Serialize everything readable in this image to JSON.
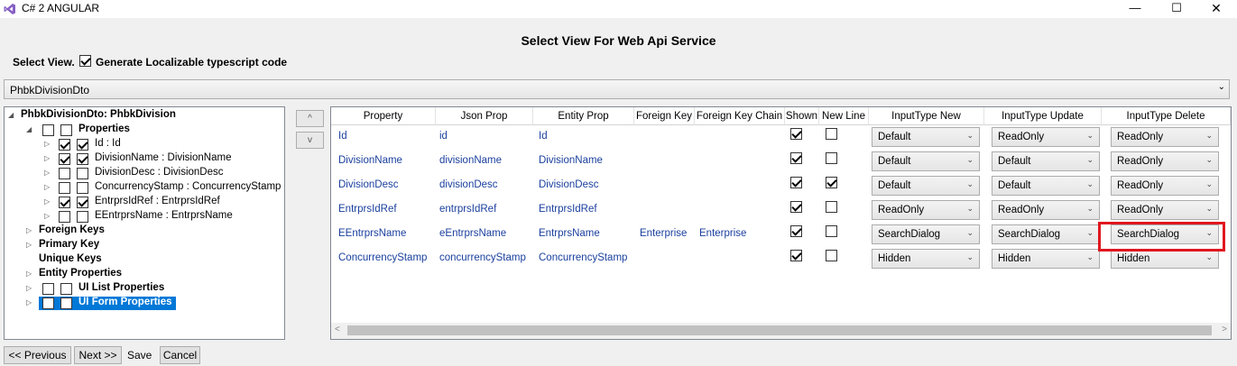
{
  "window": {
    "title": "C# 2 ANGULAR",
    "minimize": "—",
    "maximize": "☐",
    "close": "✕"
  },
  "heading": "Select View For Web Api Service",
  "select_view_label": "Select View.",
  "generate_checkbox": {
    "label": "Generate Localizable typescript code",
    "checked": true
  },
  "view_select": {
    "value": "PhbkDivisionDto",
    "arrow": "⌄"
  },
  "tree": {
    "root": "PhbkDivisionDto: PhbkDivision",
    "properties": {
      "label": "Properties",
      "checked": false
    },
    "items": [
      {
        "label": "Id : Id",
        "checked1": true,
        "checked2": true
      },
      {
        "label": "DivisionName : DivisionName",
        "checked1": true,
        "checked2": true
      },
      {
        "label": "DivisionDesc : DivisionDesc",
        "checked1": false,
        "checked2": false
      },
      {
        "label": "ConcurrencyStamp : ConcurrencyStamp",
        "checked1": false,
        "checked2": false
      },
      {
        "label": "EntrprsIdRef : EntrprsIdRef",
        "checked1": true,
        "checked2": true
      },
      {
        "label": "EEntrprsName : EntrprsName",
        "checked1": false,
        "checked2": false
      }
    ],
    "foreign_keys": "Foreign Keys",
    "primary_key": "Primary Key",
    "unique_keys": "Unique Keys",
    "entity_properties": "Entity Properties",
    "ui_list_properties": "UI List Properties",
    "ui_form_properties": "UI Form Properties"
  },
  "move_up": "^",
  "move_down": "v",
  "grid": {
    "columns": [
      "Property",
      "Json Prop",
      "Entity Prop",
      "Foreign Key",
      "Foreign Key Chain",
      "Shown",
      "New Line",
      "InputType New",
      "InputType Update",
      "InputType Delete"
    ],
    "rows": [
      {
        "property": "Id",
        "json_prop": "id",
        "entity_prop": "Id",
        "foreign_key": "",
        "foreign_key_chain": "",
        "shown": true,
        "new_line": false,
        "input_new": "Default",
        "input_update": "ReadOnly",
        "input_delete": "ReadOnly"
      },
      {
        "property": "DivisionName",
        "json_prop": "divisionName",
        "entity_prop": "DivisionName",
        "foreign_key": "",
        "foreign_key_chain": "",
        "shown": true,
        "new_line": false,
        "input_new": "Default",
        "input_update": "Default",
        "input_delete": "ReadOnly"
      },
      {
        "property": "DivisionDesc",
        "json_prop": "divisionDesc",
        "entity_prop": "DivisionDesc",
        "foreign_key": "",
        "foreign_key_chain": "",
        "shown": true,
        "new_line": true,
        "input_new": "Default",
        "input_update": "Default",
        "input_delete": "ReadOnly"
      },
      {
        "property": "EntrprsIdRef",
        "json_prop": "entrprsIdRef",
        "entity_prop": "EntrprsIdRef",
        "foreign_key": "",
        "foreign_key_chain": "",
        "shown": true,
        "new_line": false,
        "input_new": "ReadOnly",
        "input_update": "ReadOnly",
        "input_delete": "ReadOnly"
      },
      {
        "property": "EEntrprsName",
        "json_prop": "eEntrprsName",
        "entity_prop": "EntrprsName",
        "foreign_key": "Enterprise",
        "foreign_key_chain": "Enterprise",
        "shown": true,
        "new_line": false,
        "input_new": "SearchDialog",
        "input_update": "SearchDialog",
        "input_delete": "SearchDialog"
      },
      {
        "property": "ConcurrencyStamp",
        "json_prop": "concurrencyStamp",
        "entity_prop": "ConcurrencyStamp",
        "foreign_key": "",
        "foreign_key_chain": "",
        "shown": true,
        "new_line": false,
        "input_new": "Hidden",
        "input_update": "Hidden",
        "input_delete": "Hidden"
      }
    ],
    "highlight_color": "#e0161f"
  },
  "footer": {
    "previous": "<< Previous",
    "next": "Next >>",
    "save": "Save",
    "cancel": "Cancel"
  },
  "colors": {
    "selection": "#0078d7",
    "link_text": "#1a3f9e"
  }
}
